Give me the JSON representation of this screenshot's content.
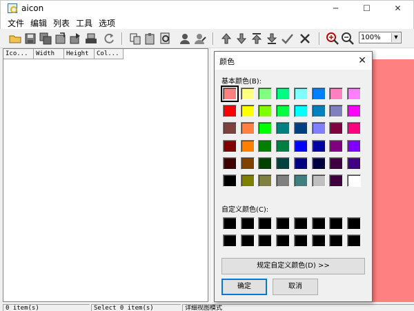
{
  "window": {
    "title": "aicon",
    "minimize_glyph": "─",
    "maximize_glyph": "☐",
    "close_glyph": "✕"
  },
  "menu": [
    "文件",
    "编辑",
    "列表",
    "工具",
    "选项"
  ],
  "toolbar": {
    "zoom_value": "100%",
    "icons": [
      "open-folder-icon",
      "save-icon",
      "save-all-icon",
      "export-icon",
      "extract-icon",
      "refresh-icon",
      "copy-icon",
      "paste-icon",
      "find-icon",
      "user-icon",
      "user-edit-icon",
      "move-up-icon",
      "move-down-icon",
      "move-top-icon",
      "move-bottom-icon",
      "check-icon",
      "delete-icon",
      "zoom-in-icon",
      "zoom-out-icon"
    ]
  },
  "list": {
    "columns": [
      "Ico...",
      "Width",
      "Height",
      "Col..."
    ]
  },
  "status": {
    "count": "0 item(s)",
    "selected": "Select 0 item(s)",
    "mode": "详细视图模式"
  },
  "colors": {
    "preview_background": "#ff8080",
    "accent": "#0078d7"
  },
  "color_dialog": {
    "title": "颜色",
    "close_glyph": "✕",
    "basic_colors_label": "基本颜色(B):",
    "custom_colors_label": "自定义颜色(C):",
    "define_custom_button": "规定自定义颜色(D) >>",
    "ok_button": "确定",
    "cancel_button": "取消",
    "basic_colors": [
      [
        "#ff8080",
        "#ffff80",
        "#80ff80",
        "#00ff80",
        "#80ffff",
        "#0080ff",
        "#ff80c0",
        "#ff80ff"
      ],
      [
        "#ff0000",
        "#ffff00",
        "#80ff00",
        "#00ff40",
        "#00ffff",
        "#0080c0",
        "#8080c0",
        "#ff00ff"
      ],
      [
        "#804040",
        "#ff8040",
        "#00ff00",
        "#008080",
        "#004080",
        "#8080ff",
        "#800040",
        "#ff0080"
      ],
      [
        "#800000",
        "#ff8000",
        "#008000",
        "#008040",
        "#0000ff",
        "#0000a0",
        "#800080",
        "#8000ff"
      ],
      [
        "#400000",
        "#804000",
        "#004000",
        "#004040",
        "#000080",
        "#000040",
        "#400040",
        "#400080"
      ],
      [
        "#000000",
        "#808000",
        "#808040",
        "#808080",
        "#408080",
        "#c0c0c0",
        "#400040",
        "#ffffff"
      ]
    ],
    "selected_basic_color": "#ff8080",
    "custom_colors": [
      [
        "#000000",
        "#000000",
        "#000000",
        "#000000",
        "#000000",
        "#000000",
        "#000000",
        "#000000"
      ],
      [
        "#000000",
        "#000000",
        "#000000",
        "#000000",
        "#000000",
        "#000000",
        "#000000",
        "#000000"
      ]
    ]
  }
}
